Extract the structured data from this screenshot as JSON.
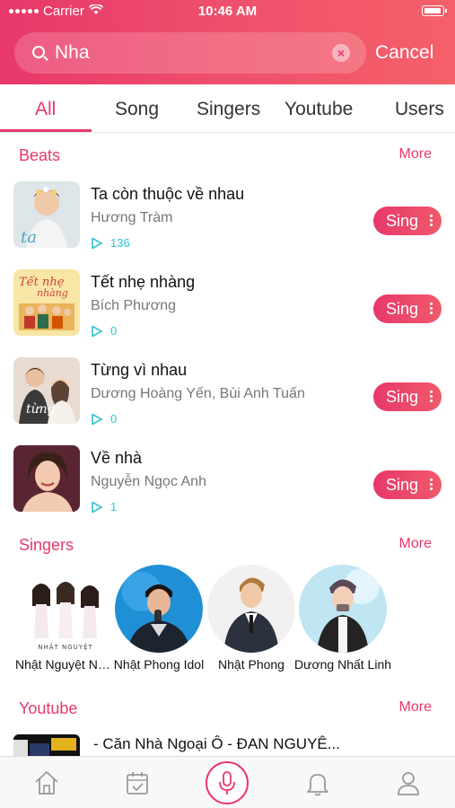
{
  "status": {
    "carrier": "Carrier",
    "time": "10:46 AM"
  },
  "search": {
    "query": "Nha",
    "cancel_label": "Cancel"
  },
  "tabs": [
    {
      "label": "All",
      "active": true
    },
    {
      "label": "Song",
      "active": false
    },
    {
      "label": "Singers",
      "active": false
    },
    {
      "label": "Youtube",
      "active": false
    },
    {
      "label": "Users",
      "active": false
    }
  ],
  "beats": {
    "title": "Beats",
    "more": "More",
    "items": [
      {
        "title": "Ta còn thuộc về nhau",
        "artist": "Hương Tràm",
        "plays": "136",
        "sing": "Sing"
      },
      {
        "title": "Tết nhẹ nhàng",
        "artist": "Bích Phương",
        "plays": "0",
        "sing": "Sing"
      },
      {
        "title": "Từng vì nhau",
        "artist": "Dương Hoàng Yến, Bùi Anh Tuấn",
        "plays": "0",
        "sing": "Sing"
      },
      {
        "title": "Về nhà",
        "artist": "Nguyễn Ngọc Anh",
        "plays": "1",
        "sing": "Sing"
      }
    ]
  },
  "singers": {
    "title": "Singers",
    "more": "More",
    "items": [
      {
        "name": "Nhật Nguyệt Nhung"
      },
      {
        "name": "Nhật Phong Idol"
      },
      {
        "name": "Nhật Phong"
      },
      {
        "name": "Dương Nhất Linh"
      }
    ]
  },
  "youtube": {
    "title": "Youtube",
    "more": "More",
    "items": [
      {
        "title": "- Căn Nhà Ngoại Ô - ĐAN NGUYÊ..."
      }
    ]
  },
  "nav": [
    "home-icon",
    "calendar-check-icon",
    "microphone-icon",
    "bell-icon",
    "user-icon"
  ],
  "colors": {
    "accent": "#e8386a",
    "play": "#2fc3d4"
  }
}
